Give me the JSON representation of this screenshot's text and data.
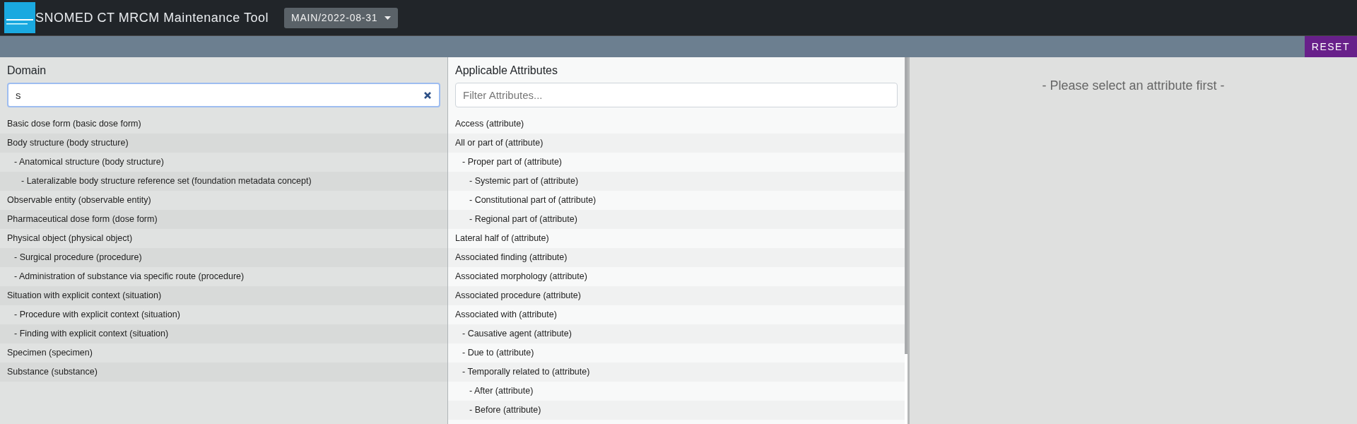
{
  "header": {
    "title": "SNOMED CT MRCM Maintenance Tool",
    "branch": "MAIN/2022-08-31"
  },
  "toolbar": {
    "reset": "RESET"
  },
  "domain": {
    "title": "Domain",
    "search": {
      "value": "s"
    },
    "items": [
      {
        "label": "Basic dose form (basic dose form)"
      },
      {
        "label": "Body structure (body structure)",
        "children": [
          {
            "label": "- Anatomical structure (body structure)",
            "children": [
              {
                "label": "- Lateralizable body structure reference set (foundation metadata concept)"
              }
            ]
          }
        ]
      },
      {
        "label": "Observable entity (observable entity)"
      },
      {
        "label": "Pharmaceutical dose form (dose form)"
      },
      {
        "label": "Physical object (physical object)",
        "children": [
          {
            "label": "- Surgical procedure (procedure)"
          },
          {
            "label": "- Administration of substance via specific route (procedure)"
          }
        ]
      },
      {
        "label": "Situation with explicit context (situation)",
        "children": [
          {
            "label": "- Procedure with explicit context (situation)"
          },
          {
            "label": "- Finding with explicit context (situation)"
          }
        ]
      },
      {
        "label": "Specimen (specimen)"
      },
      {
        "label": "Substance (substance)"
      }
    ]
  },
  "attributes": {
    "title": "Applicable Attributes",
    "filter": {
      "placeholder": "Filter Attributes..."
    },
    "items": [
      {
        "label": "Access (attribute)"
      },
      {
        "label": "All or part of (attribute)",
        "children": [
          {
            "label": "- Proper part of (attribute)",
            "children": [
              {
                "label": "- Systemic part of (attribute)"
              },
              {
                "label": "- Constitutional part of (attribute)"
              },
              {
                "label": "- Regional part of (attribute)"
              }
            ]
          }
        ]
      },
      {
        "label": "Lateral half of (attribute)"
      },
      {
        "label": "Associated finding (attribute)"
      },
      {
        "label": "Associated morphology (attribute)"
      },
      {
        "label": "Associated procedure (attribute)"
      },
      {
        "label": "Associated with (attribute)",
        "children": [
          {
            "label": "- Causative agent (attribute)"
          },
          {
            "label": "- Due to (attribute)"
          },
          {
            "label": "- Temporally related to (attribute)",
            "children": [
              {
                "label": "- After (attribute)"
              },
              {
                "label": "- Before (attribute)"
              }
            ]
          }
        ]
      }
    ]
  },
  "detail": {
    "message": "- Please select an attribute first -"
  }
}
